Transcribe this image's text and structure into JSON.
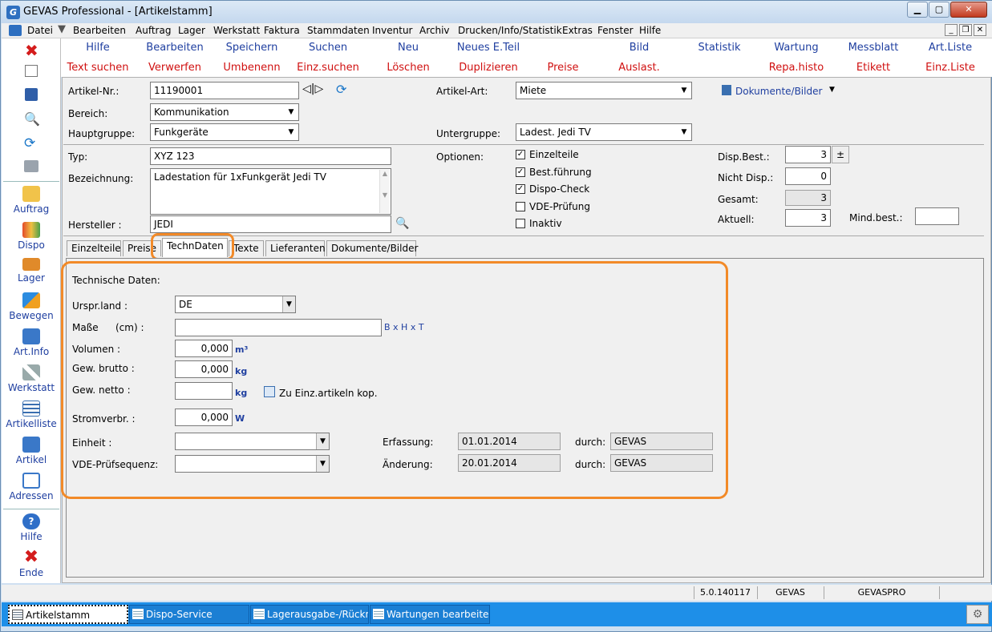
{
  "window": {
    "title": "GEVAS Professional - [Artikelstamm]"
  },
  "menu": [
    "Datei",
    "Bearbeiten",
    "Auftrag",
    "Lager",
    "Werkstatt",
    "Faktura",
    "Stammdaten",
    "Inventur",
    "Archiv",
    "Drucken/Info/Statistik",
    "Extras",
    "Fenster",
    "Hilfe"
  ],
  "toolbar": {
    "row1": [
      "Hilfe",
      "Bearbeiten",
      "Speichern",
      "Suchen",
      "Neu",
      "Neues E.Teil",
      "Bild",
      "Statistik",
      "Wartung",
      "Messblatt",
      "Art.Liste"
    ],
    "row2": [
      "Text suchen",
      "Verwerfen",
      "Umbenenn",
      "Einz.suchen",
      "Löschen",
      "Duplizieren",
      "Preise",
      "Auslast.",
      "Repa.histo",
      "Etikett",
      "Einz.Liste"
    ]
  },
  "sidebar": [
    "Auftrag",
    "Dispo",
    "Lager",
    "Bewegen",
    "Art.Info",
    "Werkstatt",
    "Artikelliste",
    "Artikel",
    "Adressen",
    "Hilfe",
    "Ende"
  ],
  "header": {
    "artikel_nr_label": "Artikel-Nr.:",
    "artikel_nr": "11190001",
    "bereich_label": "Bereich:",
    "bereich": "Kommunikation",
    "hauptgruppe_label": "Hauptgruppe:",
    "hauptgruppe": "Funkgeräte",
    "artikel_art_label": "Artikel-Art:",
    "artikel_art": "Miete",
    "untergruppe_label": "Untergruppe:",
    "untergruppe": "Ladest. Jedi TV",
    "dokumente_link": "Dokumente/Bilder",
    "typ_label": "Typ:",
    "typ": "XYZ 123",
    "bezeichnung_label": "Bezeichnung:",
    "bezeichnung": "Ladestation für 1xFunkgerät Jedi TV",
    "hersteller_label": "Hersteller :",
    "hersteller": "JEDI",
    "optionen_label": "Optionen:",
    "options": [
      {
        "label": "Einzelteile",
        "checked": true
      },
      {
        "label": "Best.führung",
        "checked": true
      },
      {
        "label": "Dispo-Check",
        "checked": true
      },
      {
        "label": "VDE-Prüfung",
        "checked": false
      },
      {
        "label": "Inaktiv",
        "checked": false
      }
    ],
    "disp_best_label": "Disp.Best.:",
    "disp_best": "3",
    "plusminus": "±",
    "nicht_disp_label": "Nicht Disp.:",
    "nicht_disp": "0",
    "gesamt_label": "Gesamt:",
    "gesamt": "3",
    "aktuell_label": "Aktuell:",
    "aktuell": "3",
    "mind_best_label": "Mind.best.:",
    "mind_best": ""
  },
  "tabs": [
    "Einzelteile",
    "Preise",
    "TechnDaten",
    "Texte",
    "Lieferanten",
    "Dokumente/Bilder"
  ],
  "active_tab": "TechnDaten",
  "tech": {
    "section_title": "Technische Daten:",
    "ursprland_label": "Urspr.land :",
    "ursprland": "DE",
    "masse_label": "Maße",
    "masse_unit_label": "(cm) :",
    "masse": "",
    "masse_hint": "B x H x T",
    "volumen_label": "Volumen :",
    "volumen": "0,000",
    "volumen_unit": "m³",
    "gew_brutto_label": "Gew. brutto :",
    "gew_brutto": "0,000",
    "gew_brutto_unit": "kg",
    "gew_netto_label": "Gew. netto :",
    "gew_netto": "",
    "gew_netto_unit": "kg",
    "copy_link": "Zu Einz.artikeln kop.",
    "stromverbr_label": "Stromverbr. :",
    "stromverbr": "0,000",
    "stromverbr_unit": "W",
    "einheit_label": "Einheit :",
    "einheit": "",
    "vde_label": "VDE-Prüfsequenz:",
    "vde": "",
    "erfassung_label": "Erfassung:",
    "erfassung": "01.01.2014",
    "aenderung_label": "Änderung:",
    "aenderung": "20.01.2014",
    "durch_label": "durch:",
    "erfassung_durch": "GEVAS",
    "aenderung_durch": "GEVAS"
  },
  "status": {
    "version": "5.0.140117",
    "user": "GEVAS",
    "db": "GEVASPRO"
  },
  "taskbar": [
    "Artikelstamm",
    "Dispo-Service",
    "Lagerausgabe-/Rückn...",
    "Wartungen bearbeiten"
  ],
  "colors": {
    "link_blue": "#1f3fa0",
    "action_red": "#d01010",
    "highlight_orange": "#f28a28",
    "taskbar_blue": "#1e8fe8"
  }
}
